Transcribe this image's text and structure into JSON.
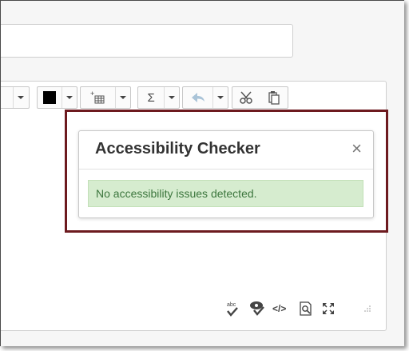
{
  "dialog": {
    "title": "Accessibility Checker",
    "close_glyph": "×",
    "message": "No accessibility issues detected."
  },
  "toolbar": {
    "math_glyph": "Σ",
    "icons": [
      "chevron-down-icon",
      "text-color-icon",
      "insert-table-icon",
      "math-icon",
      "undo-icon",
      "cut-icon",
      "paste-icon"
    ]
  },
  "statusbar": {
    "code_glyph": "</>",
    "icons": [
      "spellcheck-icon",
      "accessibility-icon",
      "html-code-icon",
      "preview-icon",
      "fullscreen-icon",
      "resize-handle-icon"
    ]
  },
  "colors": {
    "highlight_border": "#6d1a1f",
    "success_bg": "#d6eccf",
    "success_text": "#3c763d",
    "text_color_swatch": "#000000"
  }
}
